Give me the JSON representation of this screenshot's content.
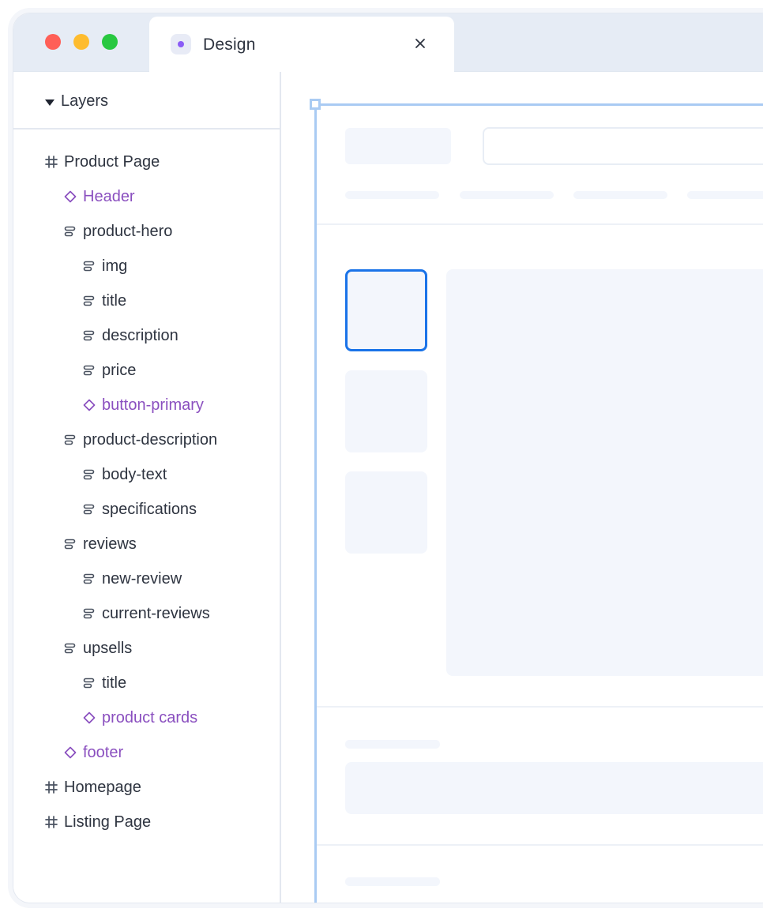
{
  "window": {
    "tab": {
      "title": "Design",
      "close_icon": "close-icon"
    }
  },
  "sidebar": {
    "header": {
      "title": "Layers"
    },
    "tree": [
      {
        "label": "Product Page",
        "icon": "frame-icon",
        "kind": "frame",
        "depth": 0
      },
      {
        "label": "Header",
        "icon": "component-icon",
        "kind": "component",
        "depth": 1
      },
      {
        "label": "product-hero",
        "icon": "stack-icon",
        "kind": "group",
        "depth": 1
      },
      {
        "label": "img",
        "icon": "stack-icon",
        "kind": "group",
        "depth": 2
      },
      {
        "label": "title",
        "icon": "stack-icon",
        "kind": "group",
        "depth": 2
      },
      {
        "label": "description",
        "icon": "stack-icon",
        "kind": "group",
        "depth": 2
      },
      {
        "label": "price",
        "icon": "stack-icon",
        "kind": "group",
        "depth": 2
      },
      {
        "label": "button-primary",
        "icon": "component-icon",
        "kind": "component",
        "depth": 2
      },
      {
        "label": "product-description",
        "icon": "stack-icon",
        "kind": "group",
        "depth": 1
      },
      {
        "label": "body-text",
        "icon": "stack-icon",
        "kind": "group",
        "depth": 2
      },
      {
        "label": "specifications",
        "icon": "stack-icon",
        "kind": "group",
        "depth": 2
      },
      {
        "label": "reviews",
        "icon": "stack-icon",
        "kind": "group",
        "depth": 1
      },
      {
        "label": "new-review",
        "icon": "stack-icon",
        "kind": "group",
        "depth": 2
      },
      {
        "label": "current-reviews",
        "icon": "stack-icon",
        "kind": "group",
        "depth": 2
      },
      {
        "label": "upsells",
        "icon": "stack-icon",
        "kind": "group",
        "depth": 1
      },
      {
        "label": "title",
        "icon": "stack-icon",
        "kind": "group",
        "depth": 2
      },
      {
        "label": "product cards",
        "icon": "component-icon",
        "kind": "component",
        "depth": 2
      },
      {
        "label": "footer",
        "icon": "component-icon",
        "kind": "component",
        "depth": 1
      },
      {
        "label": "Homepage",
        "icon": "frame-icon",
        "kind": "frame",
        "depth": 0
      },
      {
        "label": "Listing Page",
        "icon": "frame-icon",
        "kind": "frame",
        "depth": 0
      }
    ]
  },
  "colors": {
    "component": "#8a4fbf",
    "text": "#2e3440",
    "selection": "#1a73e8",
    "frame_outline": "#a9cbf3",
    "skeleton": "#f3f6fc"
  }
}
